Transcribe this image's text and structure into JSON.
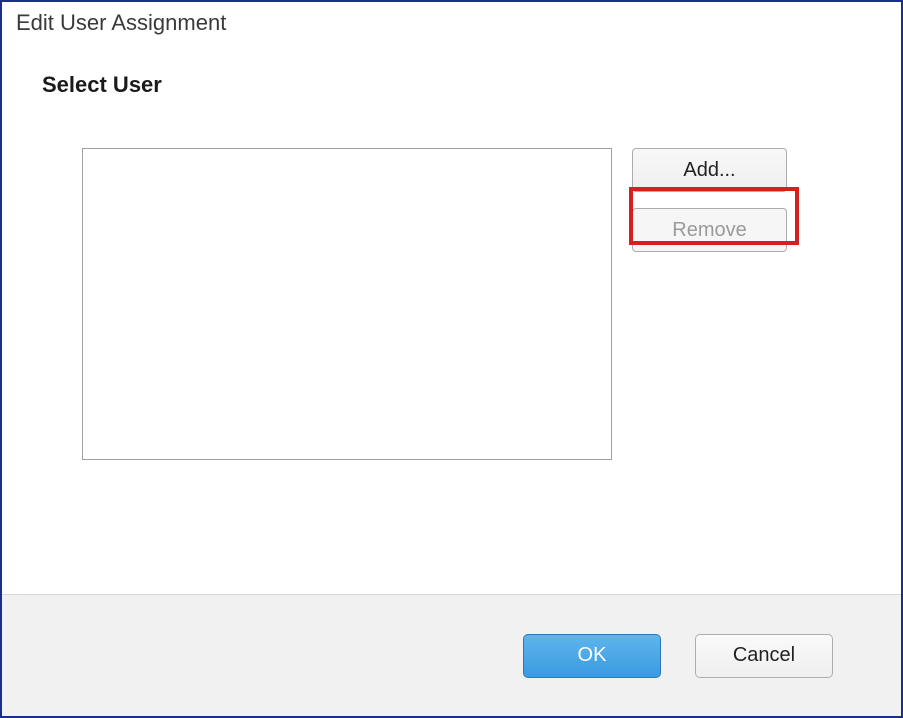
{
  "window": {
    "title": "Edit User Assignment"
  },
  "content": {
    "heading": "Select User",
    "buttons": {
      "add": "Add...",
      "remove": "Remove"
    }
  },
  "footer": {
    "ok": "OK",
    "cancel": "Cancel"
  }
}
